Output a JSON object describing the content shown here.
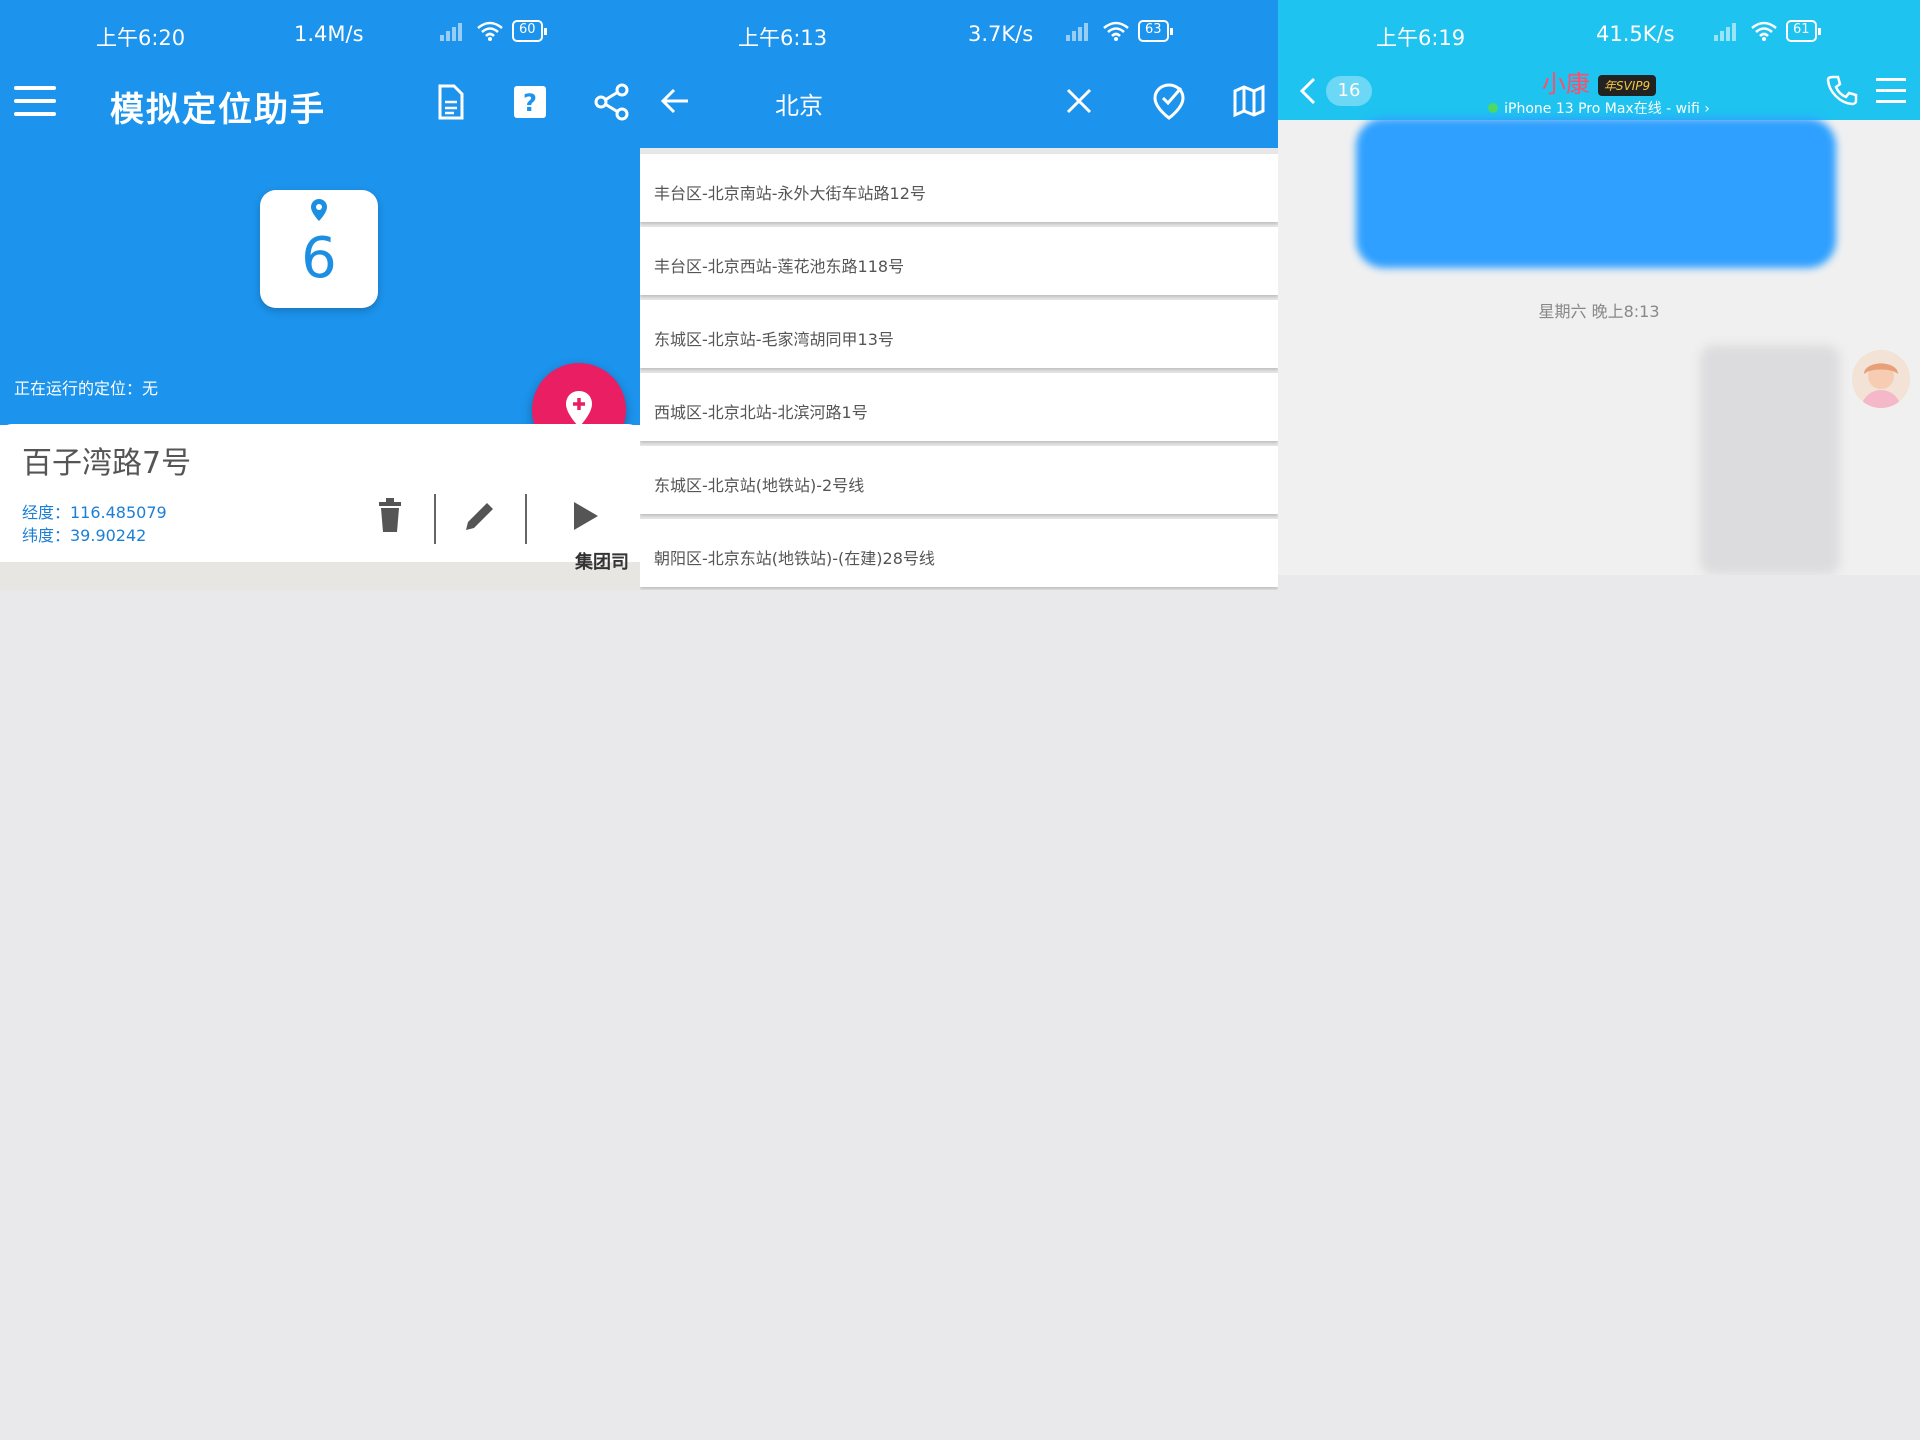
{
  "panel1": {
    "status": {
      "time": "上午6:20",
      "speed": "1.4M/s",
      "battery": "60"
    },
    "app_title": "模拟定位助手",
    "counter": "6",
    "running_label": "正在运行的定位：无",
    "card": {
      "address": "百子湾路7号",
      "longitude": "经度：116.485079",
      "latitude": "纬度：39.90242"
    },
    "map_partial_text": "集团司"
  },
  "panel2": {
    "status": {
      "time": "上午6:13",
      "speed": "3.7K/s",
      "battery": "63"
    },
    "search_query": "北京",
    "results": [
      "丰台区-北京南站-永外大街车站路12号",
      "丰台区-北京西站-莲花池东路118号",
      "东城区-北京站-毛家湾胡同甲13号",
      "西城区-北京北站-北滨河路1号",
      "东城区-北京站(地铁站)-2号线",
      "朝阳区-北京东站(地铁站)-(在建)28号线"
    ]
  },
  "panel3": {
    "status": {
      "time": "上午6:19",
      "speed": "41.5K/s",
      "battery": "61"
    },
    "unread_count": "16",
    "contact_name": "小康",
    "vip_badge": "年SVIP9",
    "device_status": "iPhone 13 Pro Max在线 - wifi ›",
    "message_time": "星期六 晚上8:13"
  },
  "colors": {
    "primary_blue": "#1c93ec",
    "fab_pink": "#e91e63",
    "chat_cyan": "#1ec3f0"
  }
}
